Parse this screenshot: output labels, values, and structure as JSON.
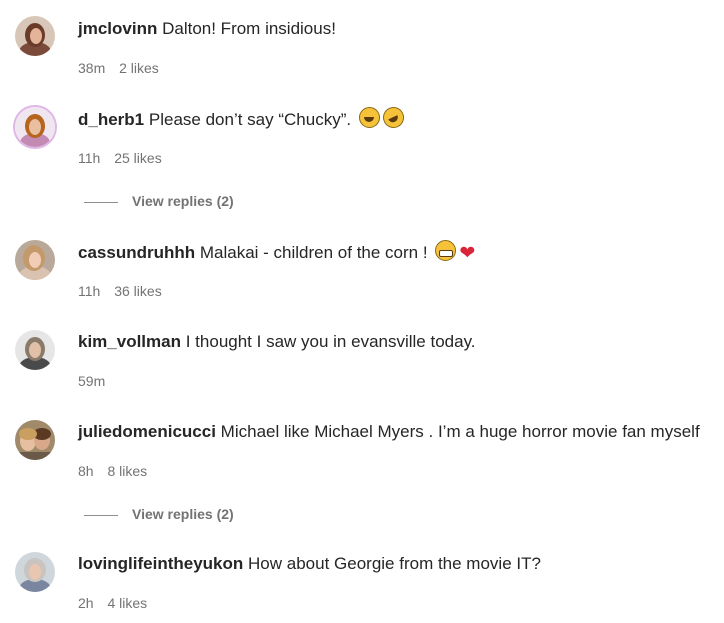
{
  "comments": [
    {
      "username": "jmclovinn",
      "text": "Dalton! From insidious!",
      "time": "38m",
      "likes": "2 likes"
    },
    {
      "username": "d_herb1",
      "text": "Please don’t say “Chucky”.",
      "time": "11h",
      "likes": "25 likes",
      "view_replies": "View replies (2)",
      "emojis": [
        "grinning-squinting-face",
        "rolling-on-floor-laughing"
      ]
    },
    {
      "username": "cassundruhhh",
      "text": "Malakai - children of the corn !",
      "time": "11h",
      "likes": "36 likes",
      "emojis": [
        "grimacing-face",
        "red-heart"
      ]
    },
    {
      "username": "kim_vollman",
      "text": "I thought I saw you in evansville today.",
      "time": "59m"
    },
    {
      "username": "juliedomenicucci",
      "text": "Michael like Michael Myers . I’m a huge horror movie fan myself",
      "time": "8h",
      "likes": "8 likes",
      "view_replies": "View replies (2)"
    },
    {
      "username": "lovinglifeintheyukon",
      "text": "How about Georgie from the movie IT?",
      "time": "2h",
      "likes": "4 likes"
    }
  ],
  "colors": {
    "text": "#262626",
    "meta": "#737373",
    "heart": "#d9243a",
    "story_ring": "#e0b6e6"
  }
}
